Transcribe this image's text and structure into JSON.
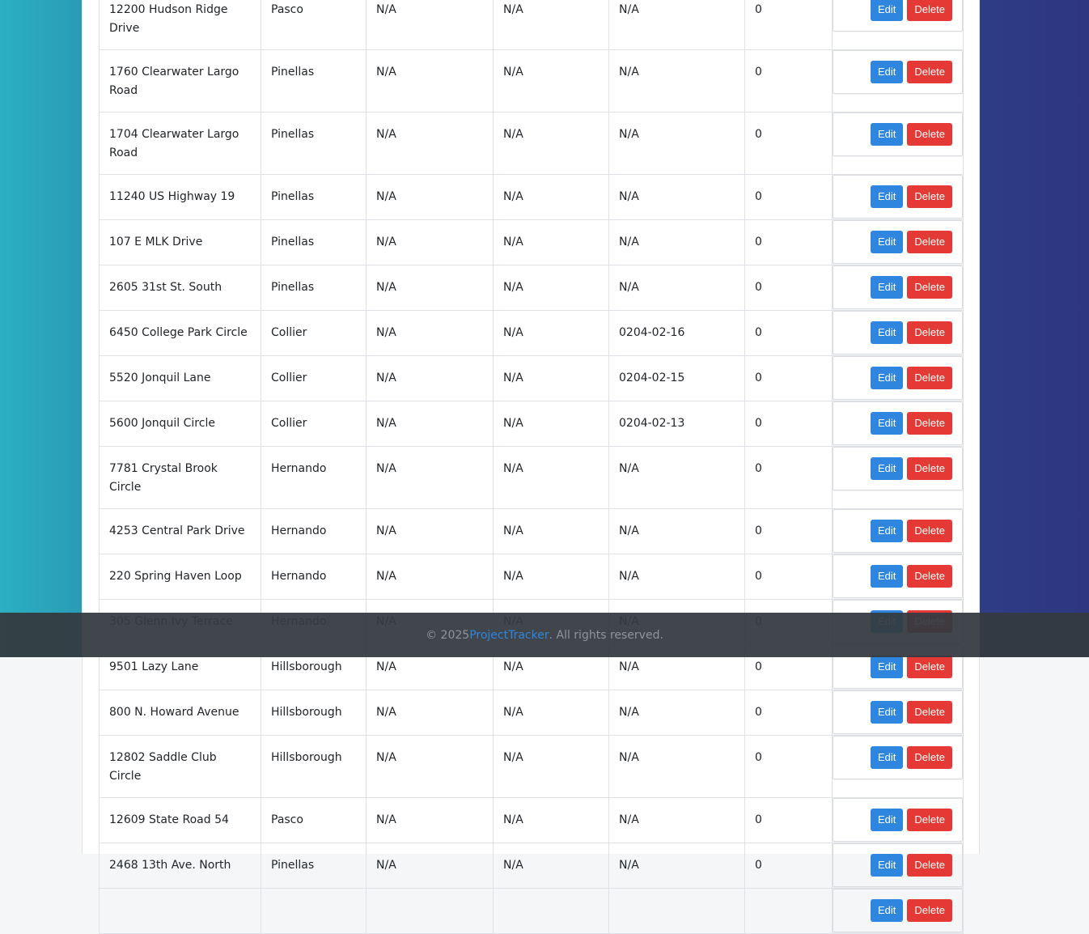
{
  "table": {
    "rows": [
      {
        "address": "12200 Hudson Ridge Drive",
        "county": "Pasco",
        "c3": "N/A",
        "c4": "N/A",
        "c5": "N/A",
        "c6": "0"
      },
      {
        "address": "1760 Clearwater Largo Road",
        "county": "Pinellas",
        "c3": "N/A",
        "c4": "N/A",
        "c5": "N/A",
        "c6": "0"
      },
      {
        "address": "1704 Clearwater Largo Road",
        "county": "Pinellas",
        "c3": "N/A",
        "c4": "N/A",
        "c5": "N/A",
        "c6": "0"
      },
      {
        "address": "11240 US Highway 19",
        "county": "Pinellas",
        "c3": "N/A",
        "c4": "N/A",
        "c5": "N/A",
        "c6": "0"
      },
      {
        "address": "107 E MLK Drive",
        "county": "Pinellas",
        "c3": "N/A",
        "c4": "N/A",
        "c5": "N/A",
        "c6": "0"
      },
      {
        "address": "2605 31st St. South",
        "county": "Pinellas",
        "c3": "N/A",
        "c4": "N/A",
        "c5": "N/A",
        "c6": "0"
      },
      {
        "address": "6450 College Park Circle",
        "county": "Collier",
        "c3": "N/A",
        "c4": "N/A",
        "c5": "0204-02-16",
        "c6": "0"
      },
      {
        "address": "5520 Jonquil Lane",
        "county": "Collier",
        "c3": "N/A",
        "c4": "N/A",
        "c5": "0204-02-15",
        "c6": "0"
      },
      {
        "address": "5600 Jonquil Circle",
        "county": "Collier",
        "c3": "N/A",
        "c4": "N/A",
        "c5": "0204-02-13",
        "c6": "0"
      },
      {
        "address": "7781 Crystal Brook Circle",
        "county": "Hernando",
        "c3": "N/A",
        "c4": "N/A",
        "c5": "N/A",
        "c6": "0"
      },
      {
        "address": "4253 Central Park Drive",
        "county": "Hernando",
        "c3": "N/A",
        "c4": "N/A",
        "c5": "N/A",
        "c6": "0"
      },
      {
        "address": "220 Spring Haven Loop",
        "county": "Hernando",
        "c3": "N/A",
        "c4": "N/A",
        "c5": "N/A",
        "c6": "0"
      },
      {
        "address": "305 Glenn Ivy Terrace",
        "county": "Hernando",
        "c3": "N/A",
        "c4": "N/A",
        "c5": "N/A",
        "c6": "0"
      },
      {
        "address": "9501 Lazy Lane",
        "county": "Hillsborough",
        "c3": "N/A",
        "c4": "N/A",
        "c5": "N/A",
        "c6": "0"
      },
      {
        "address": "800 N. Howard Avenue",
        "county": "Hillsborough",
        "c3": "N/A",
        "c4": "N/A",
        "c5": "N/A",
        "c6": "0"
      },
      {
        "address": "12802 Saddle Club Circle",
        "county": "Hillsborough",
        "c3": "N/A",
        "c4": "N/A",
        "c5": "N/A",
        "c6": "0"
      },
      {
        "address": "12609 State Road 54",
        "county": "Pasco",
        "c3": "N/A",
        "c4": "N/A",
        "c5": "N/A",
        "c6": "0"
      },
      {
        "address": "2468 13th Ave. North",
        "county": "Pinellas",
        "c3": "N/A",
        "c4": "N/A",
        "c5": "N/A",
        "c6": "0"
      },
      {
        "address": "",
        "county": "",
        "c3": "",
        "c4": "",
        "c5": "",
        "c6": ""
      }
    ],
    "edit_label": "Edit",
    "delete_label": "Delete"
  },
  "footer": {
    "copyright": "© 2025 ",
    "brand": "ProjectTracker",
    "rights": ". All rights reserved."
  },
  "colors": {
    "edit": "#2e86de",
    "delete": "#e53935",
    "footer_bg": "#343a40",
    "brand": "#2e86de"
  }
}
